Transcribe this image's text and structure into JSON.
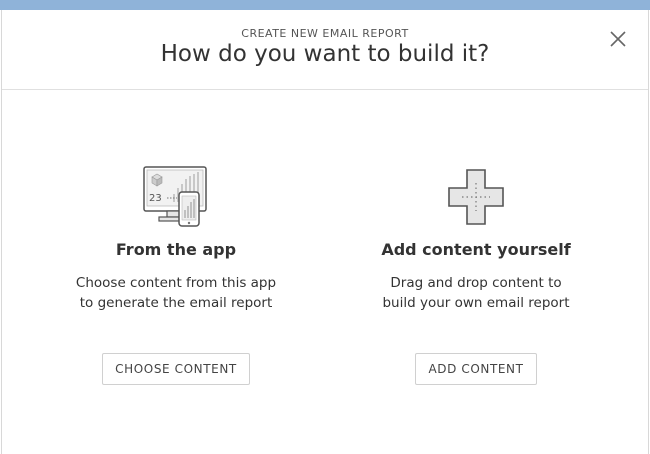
{
  "header": {
    "eyebrow": "CREATE NEW EMAIL REPORT",
    "title": "How do you want to build it?",
    "close_icon": "close-icon"
  },
  "options": [
    {
      "icon": "devices-dashboard-icon",
      "icon_number": "23",
      "title": "From the app",
      "description_lines": [
        "Choose content from this app",
        "to generate the email report"
      ],
      "button_label": "CHOOSE CONTENT"
    },
    {
      "icon": "plus-icon",
      "title": "Add content yourself",
      "description_lines": [
        "Drag and drop content to",
        "build your own email report"
      ],
      "button_label": "ADD CONTENT"
    }
  ],
  "colors": {
    "backdrop": "#8fb3d9",
    "text": "#333333",
    "border": "#d0d0d0",
    "icon_fill": "#e6e6e6",
    "icon_stroke": "#555555"
  }
}
